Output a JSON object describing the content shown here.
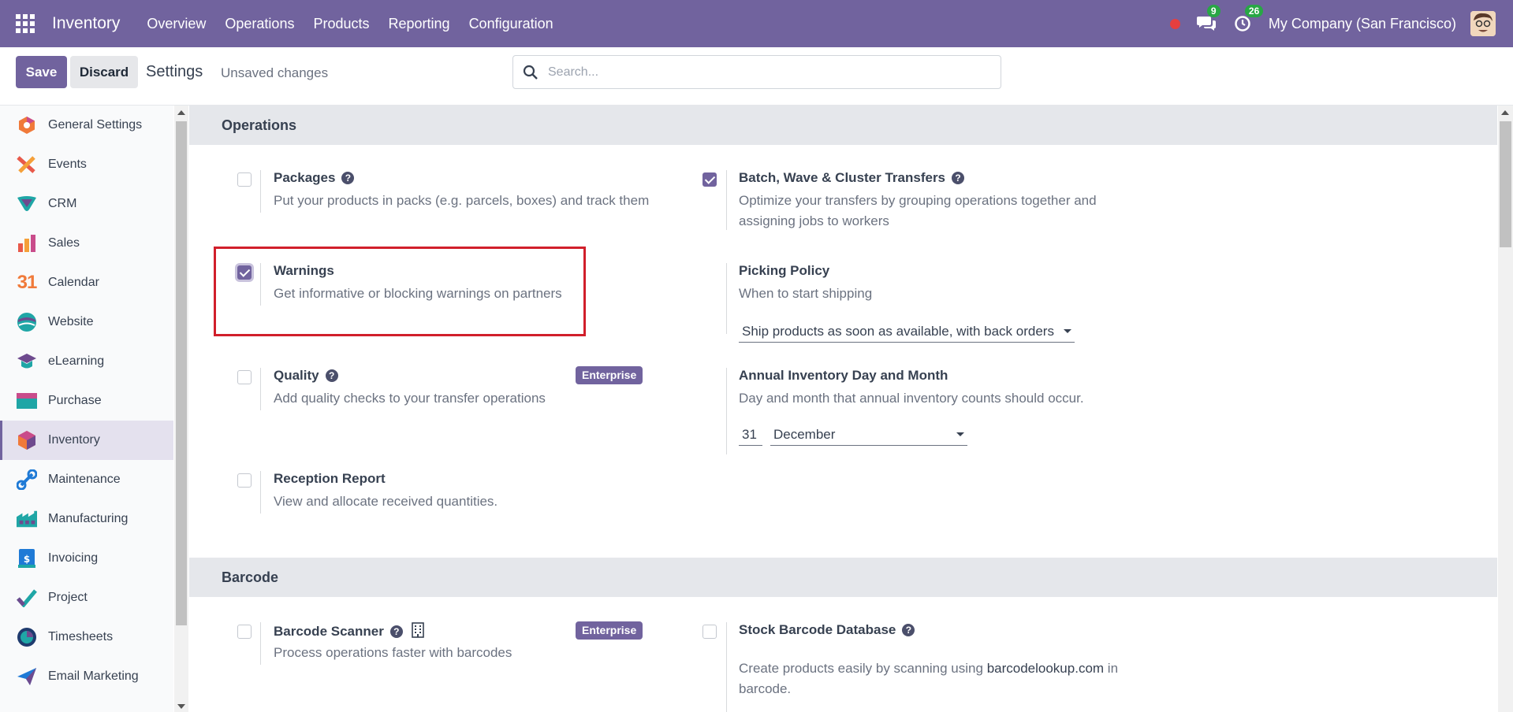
{
  "navbar": {
    "app_name": "Inventory",
    "menu": [
      "Overview",
      "Operations",
      "Products",
      "Reporting",
      "Configuration"
    ],
    "messages_count": "9",
    "activities_count": "26",
    "company": "My Company (San Francisco)"
  },
  "control_panel": {
    "save_label": "Save",
    "discard_label": "Discard",
    "title": "Settings",
    "status": "Unsaved changes",
    "search_placeholder": "Search..."
  },
  "sidebar": {
    "items": [
      {
        "label": "General Settings",
        "icon": "general-settings-icon"
      },
      {
        "label": "Events",
        "icon": "events-icon"
      },
      {
        "label": "CRM",
        "icon": "crm-icon"
      },
      {
        "label": "Sales",
        "icon": "sales-icon"
      },
      {
        "label": "Calendar",
        "icon": "calendar-icon"
      },
      {
        "label": "Website",
        "icon": "website-icon"
      },
      {
        "label": "eLearning",
        "icon": "elearning-icon"
      },
      {
        "label": "Purchase",
        "icon": "purchase-icon"
      },
      {
        "label": "Inventory",
        "icon": "inventory-icon",
        "active": true
      },
      {
        "label": "Maintenance",
        "icon": "maintenance-icon"
      },
      {
        "label": "Manufacturing",
        "icon": "manufacturing-icon"
      },
      {
        "label": "Invoicing",
        "icon": "invoicing-icon"
      },
      {
        "label": "Project",
        "icon": "project-icon"
      },
      {
        "label": "Timesheets",
        "icon": "timesheets-icon"
      },
      {
        "label": "Email Marketing",
        "icon": "email-marketing-icon"
      }
    ],
    "calendar_icon_text": "31"
  },
  "sections": {
    "operations": {
      "title": "Operations",
      "packages": {
        "title": "Packages",
        "desc": "Put your products in packs (e.g. parcels, boxes) and track them",
        "checked": false
      },
      "batch": {
        "title": "Batch, Wave & Cluster Transfers",
        "desc": "Optimize your transfers by grouping operations together and assigning jobs to workers",
        "checked": true
      },
      "warnings": {
        "title": "Warnings",
        "desc": "Get informative or blocking warnings on partners",
        "checked": true
      },
      "picking_policy": {
        "title": "Picking Policy",
        "desc": "When to start shipping",
        "value": "Ship products as soon as available, with back orders"
      },
      "quality": {
        "title": "Quality",
        "desc": "Add quality checks to your transfer operations",
        "badge": "Enterprise",
        "checked": false
      },
      "annual_inventory": {
        "title": "Annual Inventory Day and Month",
        "desc": "Day and month that annual inventory counts should occur.",
        "day": "31",
        "month": "December"
      },
      "reception_report": {
        "title": "Reception Report",
        "desc": "View and allocate received quantities.",
        "checked": false
      }
    },
    "barcode": {
      "title": "Barcode",
      "scanner": {
        "title": "Barcode Scanner",
        "desc": "Process operations faster with barcodes",
        "badge": "Enterprise",
        "checked": false
      },
      "stock_db": {
        "title": "Stock Barcode Database",
        "desc_prefix": "Create products easily by scanning using ",
        "link": "barcodelookup.com",
        "desc_suffix": " in",
        "desc_line2": "barcode.",
        "checked": false
      }
    }
  },
  "colors": {
    "brand": "#71639e",
    "highlight": "#d11f2b",
    "badge_green": "#28a745"
  }
}
